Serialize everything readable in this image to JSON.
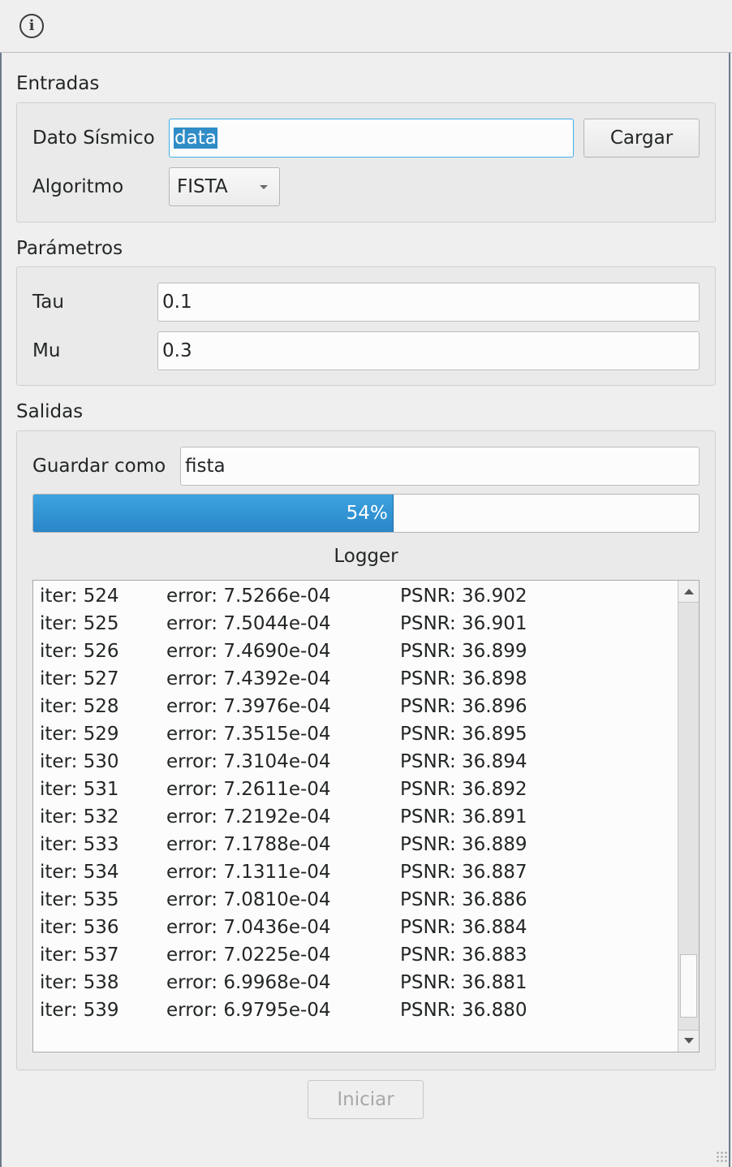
{
  "toolbar": {
    "info_icon": "info-icon"
  },
  "entradas": {
    "title": "Entradas",
    "dato_label": "Dato Sísmico",
    "dato_value": "data",
    "cargar_label": "Cargar",
    "algoritmo_label": "Algoritmo",
    "algoritmo_value": "FISTA"
  },
  "parametros": {
    "title": "Parámetros",
    "tau_label": "Tau",
    "tau_value": "0.1",
    "mu_label": "Mu",
    "mu_value": "0.3"
  },
  "salidas": {
    "title": "Salidas",
    "guardar_label": "Guardar como",
    "guardar_value": "fista",
    "progress_value": 54,
    "progress_text": "54%",
    "logger_title": "Logger",
    "log": [
      {
        "iter": "iter: 524",
        "error": "error: 7.5266e-04",
        "psnr": "PSNR: 36.902"
      },
      {
        "iter": "iter: 525",
        "error": "error: 7.5044e-04",
        "psnr": "PSNR: 36.901"
      },
      {
        "iter": "iter: 526",
        "error": "error: 7.4690e-04",
        "psnr": "PSNR: 36.899"
      },
      {
        "iter": "iter: 527",
        "error": "error: 7.4392e-04",
        "psnr": "PSNR: 36.898"
      },
      {
        "iter": "iter: 528",
        "error": "error: 7.3976e-04",
        "psnr": "PSNR: 36.896"
      },
      {
        "iter": "iter: 529",
        "error": "error: 7.3515e-04",
        "psnr": "PSNR: 36.895"
      },
      {
        "iter": "iter: 530",
        "error": "error: 7.3104e-04",
        "psnr": "PSNR: 36.894"
      },
      {
        "iter": "iter: 531",
        "error": "error: 7.2611e-04",
        "psnr": "PSNR: 36.892"
      },
      {
        "iter": "iter: 532",
        "error": "error: 7.2192e-04",
        "psnr": "PSNR: 36.891"
      },
      {
        "iter": "iter: 533",
        "error": "error: 7.1788e-04",
        "psnr": "PSNR: 36.889"
      },
      {
        "iter": "iter: 534",
        "error": "error: 7.1311e-04",
        "psnr": "PSNR: 36.887"
      },
      {
        "iter": "iter: 535",
        "error": "error: 7.0810e-04",
        "psnr": "PSNR: 36.886"
      },
      {
        "iter": "iter: 536",
        "error": "error: 7.0436e-04",
        "psnr": "PSNR: 36.884"
      },
      {
        "iter": "iter: 537",
        "error": "error: 7.0225e-04",
        "psnr": "PSNR: 36.883"
      },
      {
        "iter": "iter: 538",
        "error": "error: 6.9968e-04",
        "psnr": "PSNR: 36.881"
      },
      {
        "iter": "iter: 539",
        "error": "error: 6.9795e-04",
        "psnr": "PSNR: 36.880"
      }
    ]
  },
  "iniciar_label": "Iniciar",
  "colors": {
    "accent": "#3daee9",
    "progress": "#2a86c8",
    "selection": "#308cc6"
  }
}
